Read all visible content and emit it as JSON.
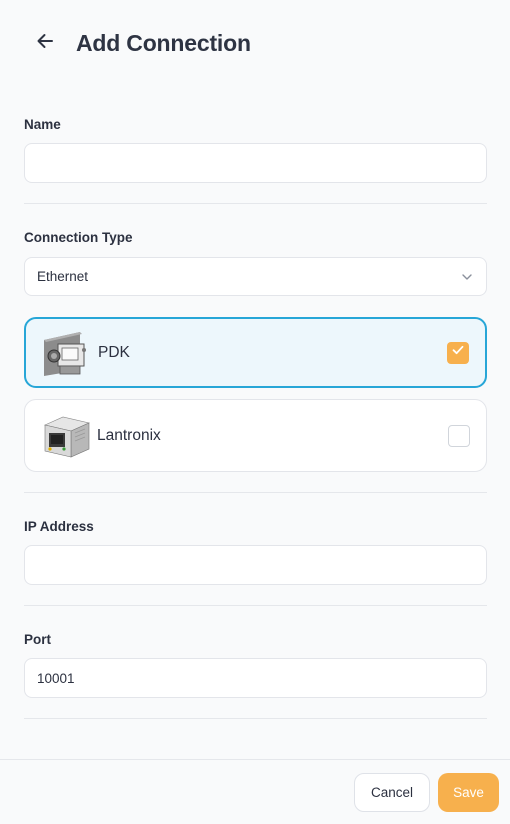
{
  "header": {
    "title": "Add Connection",
    "back_icon": "arrow-left-icon"
  },
  "form": {
    "name": {
      "label": "Name",
      "value": "",
      "placeholder": ""
    },
    "connection_type": {
      "label": "Connection Type",
      "selected": "Ethernet",
      "icon": "chevron-down-icon",
      "devices": [
        {
          "name": "PDK",
          "selected": true
        },
        {
          "name": "Lantronix",
          "selected": false
        }
      ]
    },
    "ip_address": {
      "label": "IP Address",
      "value": "",
      "placeholder": ""
    },
    "port": {
      "label": "Port",
      "value": "10001",
      "placeholder": ""
    }
  },
  "footer": {
    "cancel_label": "Cancel",
    "save_label": "Save"
  },
  "colors": {
    "accent": "#f7b04d",
    "selected_border": "#27a6d7",
    "selected_bg": "#edf7fc"
  }
}
